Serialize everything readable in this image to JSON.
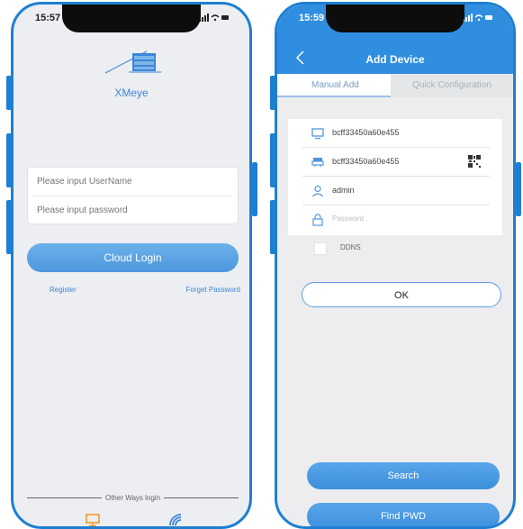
{
  "login_screen": {
    "status_time": "15:57",
    "status_icons": "▐▐ ● ▬",
    "brand_name": "XMeye",
    "username_placeholder": "Please input UserName",
    "password_placeholder": "Please input password",
    "cloud_login_label": "Cloud Login",
    "register_label": "Register",
    "forgot_password_label": "Forget Password",
    "other_ways_label": "Other Ways login",
    "icons": [
      "monitor-icon",
      "wifi-icon"
    ]
  },
  "add_device_screen": {
    "status_time": "15:59",
    "status_icons": "▐▐ ● ▬",
    "title": "Add Device",
    "tabs": [
      {
        "label": "Manual Add",
        "active": true
      },
      {
        "label": "Quick Configuration",
        "active": false
      }
    ],
    "fields": {
      "device_name": "bcff33450a60e455",
      "serial_number": "bcff33450a60e455",
      "username": "admin",
      "password_placeholder": "Password"
    },
    "ddns_label": "DDNS",
    "ddns_checked": false,
    "ok_label": "OK",
    "search_label": "Search",
    "find_pwd_label": "Find PWD"
  },
  "colors": {
    "frame_blue": "#1e7fd2",
    "header_blue": "#2f8ee0",
    "button_blue": "#4d97dc",
    "link_blue": "#3c86d8",
    "background": "#eceef1"
  }
}
